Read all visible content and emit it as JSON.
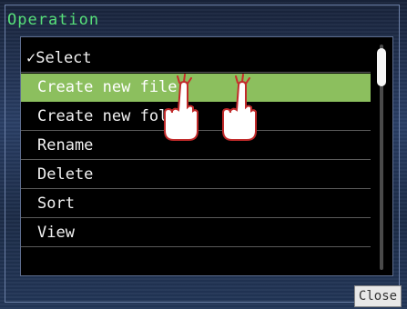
{
  "window": {
    "title": "Operation"
  },
  "menu": {
    "items": [
      {
        "label": "✓Select",
        "selected": false
      },
      {
        "label": "Create new file",
        "selected": true
      },
      {
        "label": "Create new folder",
        "selected": false
      },
      {
        "label": "Rename",
        "selected": false
      },
      {
        "label": "Delete",
        "selected": false
      },
      {
        "label": "Sort",
        "selected": false
      },
      {
        "label": "View",
        "selected": false
      }
    ]
  },
  "footer": {
    "close_label": "Close"
  },
  "colors": {
    "title": "#57e07a",
    "highlight": "#8cbf5e",
    "panel_bg": "#000000",
    "window_bg": "#1f3050"
  },
  "icons": [
    "tap-hand-icon",
    "tap-hand-icon"
  ]
}
